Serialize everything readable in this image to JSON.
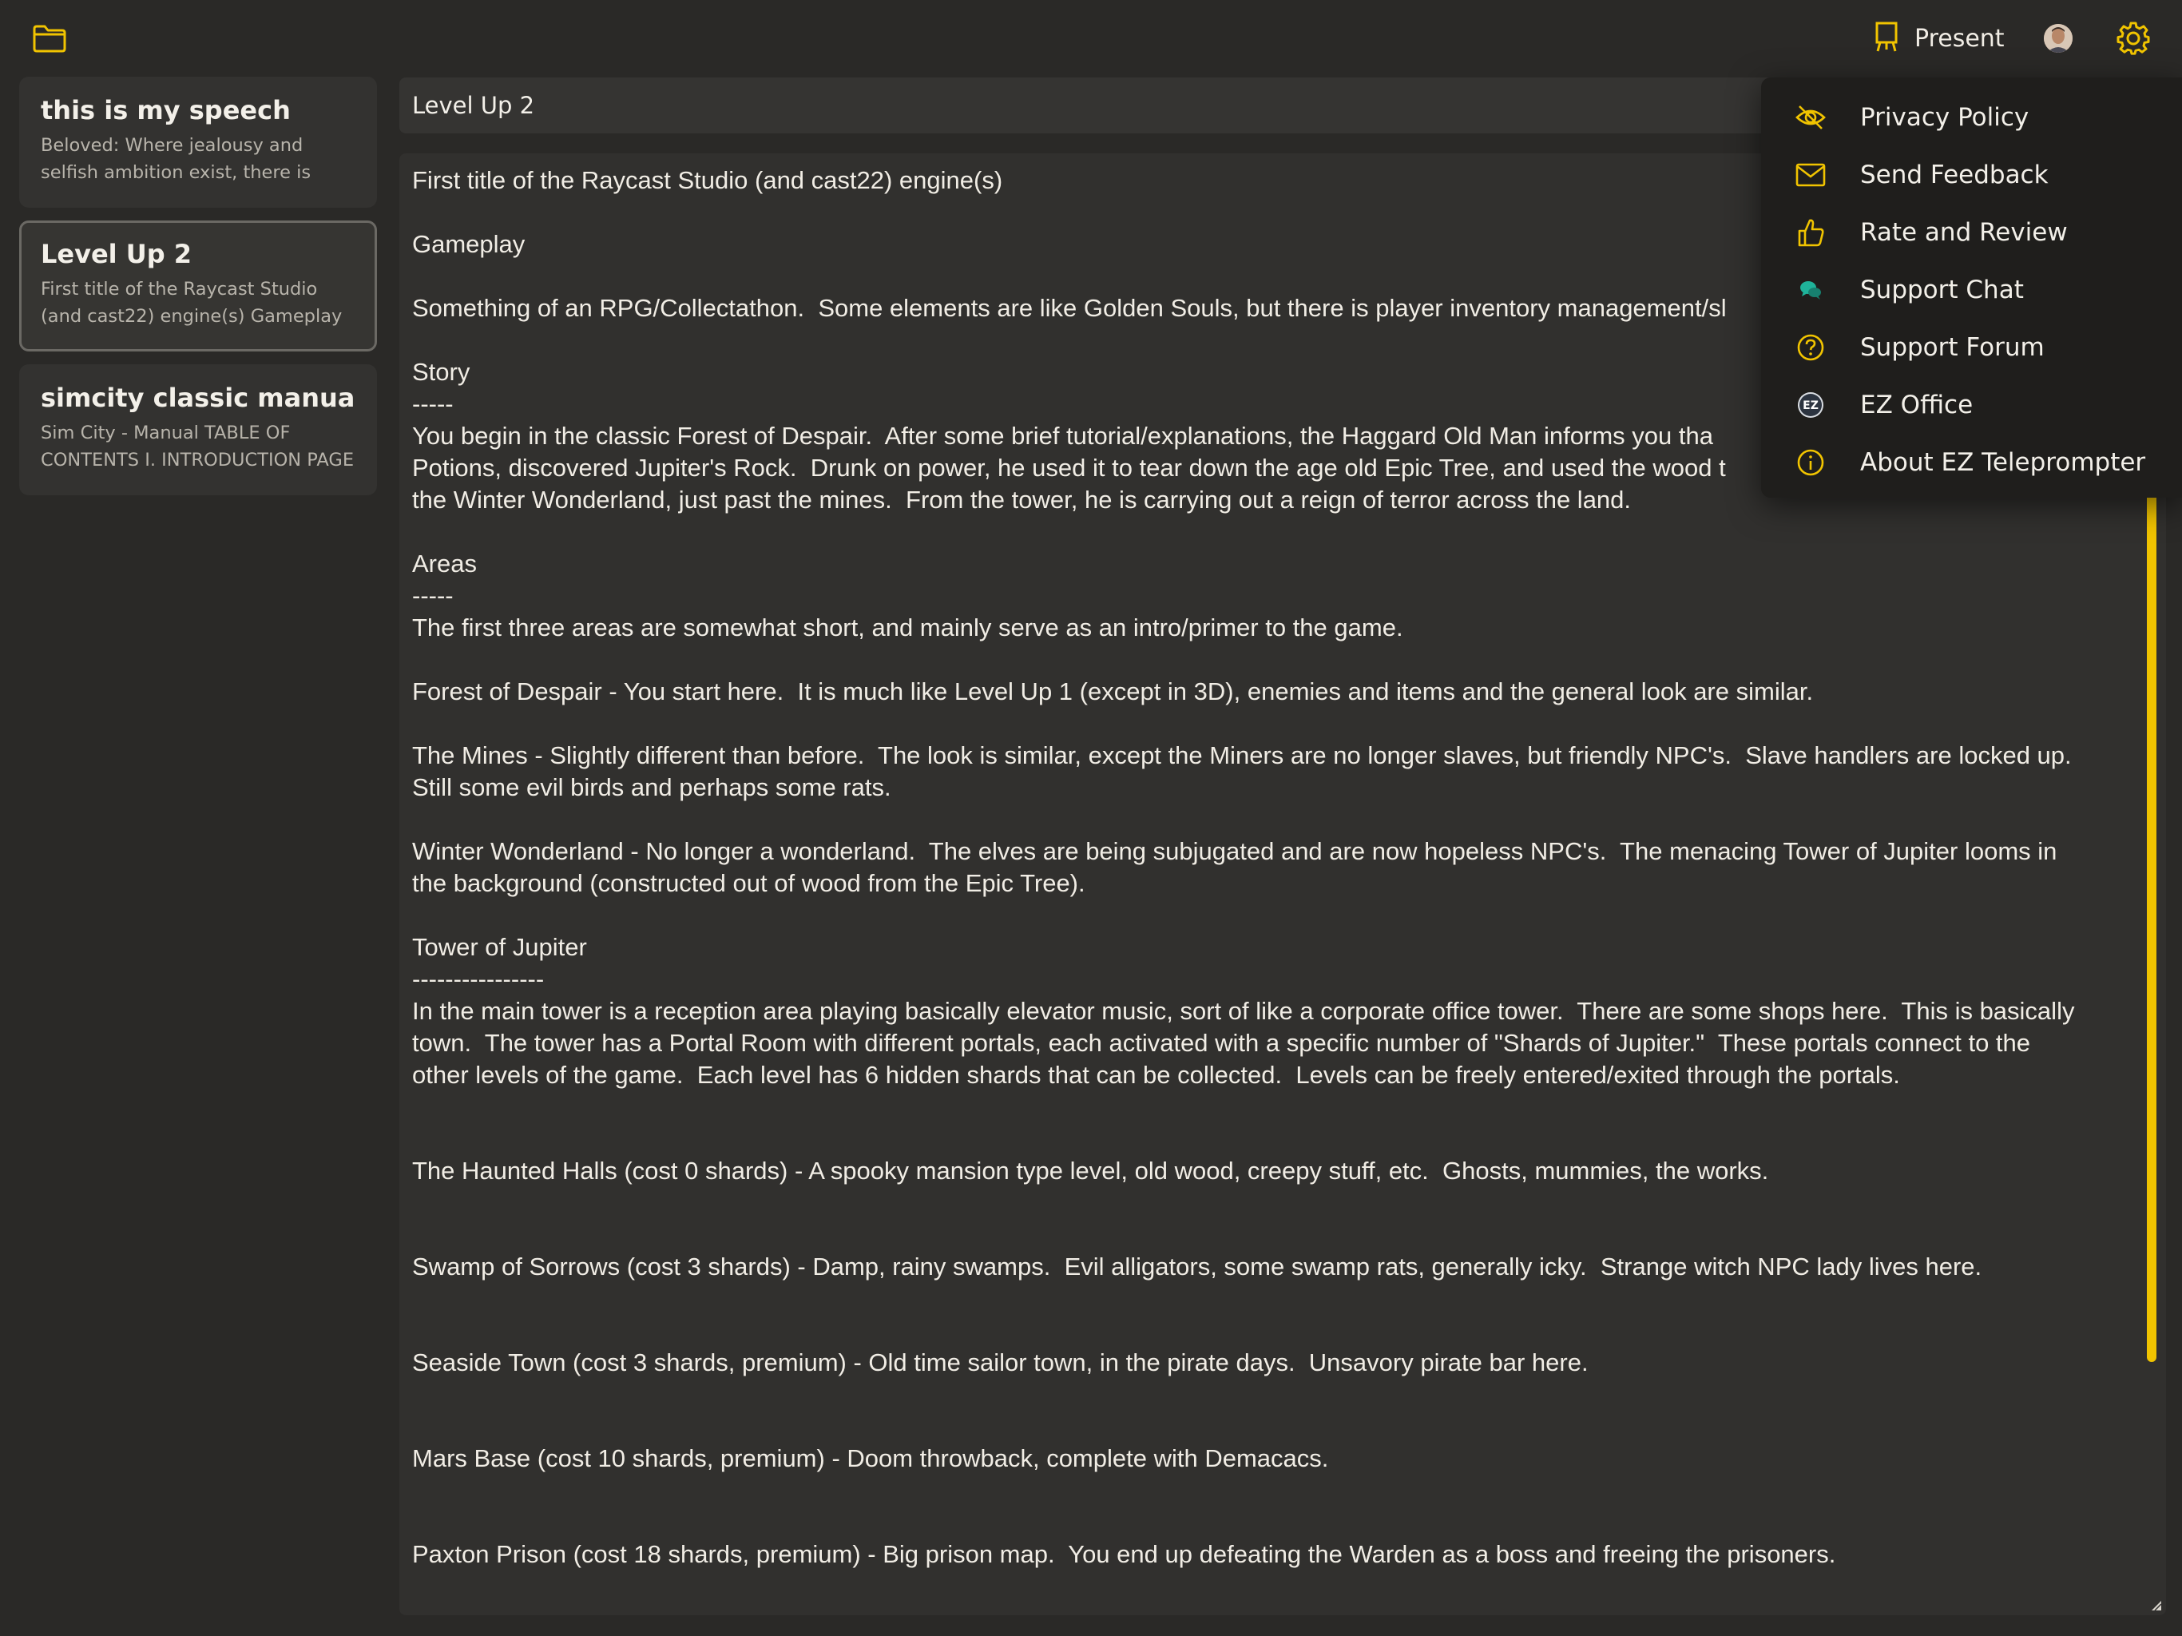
{
  "topbar": {
    "present_label": "Present"
  },
  "accent_color": "#f1c400",
  "sidebar": {
    "documents": [
      {
        "title": "this is my speech",
        "preview": "Beloved: Where jealousy and selfish ambition exist, there is"
      },
      {
        "title": "Level Up 2",
        "preview": "First title of the Raycast Studio (and cast22) engine(s) Gameplay",
        "selected": true
      },
      {
        "title": "simcity classic manual",
        "preview": "Sim City - Manual TABLE OF CONTENTS I. INTRODUCTION PAGE"
      }
    ]
  },
  "editor": {
    "title": "Level Up 2",
    "body": "First title of the Raycast Studio (and cast22) engine(s)\n\nGameplay\n\nSomething of an RPG/Collectathon.  Some elements are like Golden Souls, but there is player inventory management/sl\n\nStory\n-----\nYou begin in the classic Forest of Despair.  After some brief tutorial/explanations, the Haggard Old Man informs you tha\nPotions, discovered Jupiter's Rock.  Drunk on power, he used it to tear down the age old Epic Tree, and used the wood t\nthe Winter Wonderland, just past the mines.  From the tower, he is carrying out a reign of terror across the land.\n\nAreas\n-----\nThe first three areas are somewhat short, and mainly serve as an intro/primer to the game.\n\nForest of Despair - You start here.  It is much like Level Up 1 (except in 3D), enemies and items and the general look are similar.\n\nThe Mines - Slightly different than before.  The look is similar, except the Miners are no longer slaves, but friendly NPC's.  Slave handlers are locked up.\nStill some evil birds and perhaps some rats.\n\nWinter Wonderland - No longer a wonderland.  The elves are being subjugated and are now hopeless NPC's.  The menacing Tower of Jupiter looms in\nthe background (constructed out of wood from the Epic Tree).\n\nTower of Jupiter\n----------------\nIn the main tower is a reception area playing basically elevator music, sort of like a corporate office tower.  There are some shops here.  This is basically\ntown.  The tower has a Portal Room with different portals, each activated with a specific number of \"Shards of Jupiter.\"  These portals connect to the\nother levels of the game.  Each level has 6 hidden shards that can be collected.  Levels can be freely entered/exited through the portals.\n\n\nThe Haunted Halls (cost 0 shards) - A spooky mansion type level, old wood, creepy stuff, etc.  Ghosts, mummies, the works.\n\n\nSwamp of Sorrows (cost 3 shards) - Damp, rainy swamps.  Evil alligators, some swamp rats, generally icky.  Strange witch NPC lady lives here.\n\n\nSeaside Town (cost 3 shards, premium) - Old time sailor town, in the pirate days.  Unsavory pirate bar here.\n\n\nMars Base (cost 10 shards, premium) - Doom throwback, complete with Demacacs.\n\n\nPaxton Prison (cost 18 shards, premium) - Big prison map.  You end up defeating the Warden as a boss and freeing the prisoners."
  },
  "settings_menu": {
    "items": [
      {
        "label": "Privacy Policy",
        "icon": "eye-slash-icon"
      },
      {
        "label": "Send Feedback",
        "icon": "envelope-icon"
      },
      {
        "label": "Rate and Review",
        "icon": "thumbs-up-icon"
      },
      {
        "label": "Support Chat",
        "icon": "chat-bubbles-icon"
      },
      {
        "label": "Support Forum",
        "icon": "question-circle-icon"
      },
      {
        "label": "EZ Office",
        "icon": "ez-logo-icon"
      },
      {
        "label": "About EZ Teleprompter",
        "icon": "info-circle-icon"
      }
    ]
  }
}
